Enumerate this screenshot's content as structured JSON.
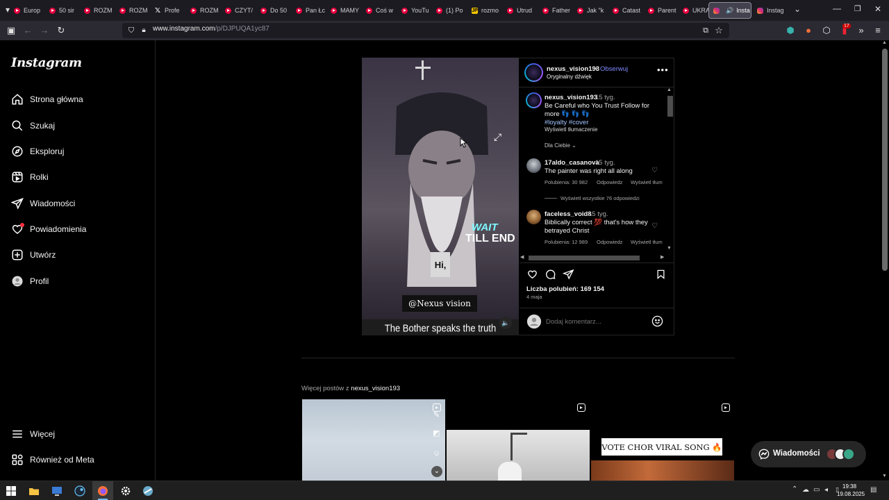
{
  "browser": {
    "tabs": [
      {
        "label": "Europ",
        "icon": "youtube-icon"
      },
      {
        "label": "50 sir",
        "icon": "youtube-icon"
      },
      {
        "label": "ROZM",
        "icon": "youtube-icon"
      },
      {
        "label": "ROZM",
        "icon": "youtube-icon"
      },
      {
        "label": "Profe",
        "icon": "x-icon"
      },
      {
        "label": "ROZM",
        "icon": "youtube-icon"
      },
      {
        "label": "CZYT/",
        "icon": "youtube-icon"
      },
      {
        "label": "Do 50",
        "icon": "youtube-icon"
      },
      {
        "label": "Pan Łc",
        "icon": "youtube-icon"
      },
      {
        "label": "MAMY",
        "icon": "youtube-icon"
      },
      {
        "label": "Coś w",
        "icon": "youtube-icon"
      },
      {
        "label": "YouTu",
        "icon": "youtube-icon"
      },
      {
        "label": "(1) Po",
        "icon": "youtube-icon"
      },
      {
        "label": "rozmo",
        "icon": "jp-icon"
      },
      {
        "label": "Utrud",
        "icon": "youtube-icon"
      },
      {
        "label": "Father",
        "icon": "youtube-icon"
      },
      {
        "label": "Jak \"k",
        "icon": "youtube-icon"
      },
      {
        "label": "Catast",
        "icon": "youtube-icon"
      },
      {
        "label": "Parent",
        "icon": "youtube-icon"
      },
      {
        "label": "UKRA",
        "icon": "youtube-icon"
      }
    ],
    "active_tab": {
      "label": "Insta",
      "icon": "instagram-icon"
    },
    "next_tab": {
      "label": "Instag",
      "icon": "instagram-icon"
    },
    "url_host": "www.instagram.com",
    "url_path": "/p/DJPUQA1yc87",
    "extension_badge": "17"
  },
  "sidebar": {
    "logo": "Instagram",
    "items": [
      {
        "label": "Strona główna",
        "icon": "home-icon"
      },
      {
        "label": "Szukaj",
        "icon": "search-icon"
      },
      {
        "label": "Eksploruj",
        "icon": "explore-icon"
      },
      {
        "label": "Rolki",
        "icon": "reels-icon"
      },
      {
        "label": "Wiadomości",
        "icon": "messages-icon"
      },
      {
        "label": "Powiadomienia",
        "icon": "heart-icon"
      },
      {
        "label": "Utwórz",
        "icon": "create-icon"
      },
      {
        "label": "Profil",
        "icon": "profile-icon"
      }
    ],
    "bottom_items": [
      {
        "label": "Więcej",
        "icon": "menu-icon"
      },
      {
        "label": "Również od Meta",
        "icon": "meta-icon"
      }
    ]
  },
  "post": {
    "video_overlay": {
      "wait_text": "WAIT",
      "till_end_text": "TILL END",
      "hi_text": "Hi,",
      "watermark": "@Nexus vision",
      "caption": "The Bother speaks the truth"
    },
    "author": "nexus_vision193",
    "follow_label": "Obserwuj",
    "separator": "•",
    "audio": "Oryginalny dźwięk",
    "caption": {
      "username": "nexus_vision193",
      "age": "15 tyg.",
      "text_line1": "Be Careful who You Trust Follow for",
      "text_line2": "more 👣 👣 👣",
      "hashtags": "#loyalty #cover",
      "translate": "Wyświetl tłumaczenie"
    },
    "sort_label": "Dla Ciebie",
    "comments": [
      {
        "username": "17aldo_casanova",
        "age": "15 tyg.",
        "text_line1": "The painter was right all along",
        "text_line2": "",
        "likes": "Polubienia: 30 982",
        "reply": "Odpowiedz",
        "translate": "Wyświetl tłum"
      },
      {
        "username": "faceless_void8",
        "age": "15 tyg.",
        "text_line1": "Biblically correct 💯 that's how they",
        "text_line2": "betrayed Christ",
        "likes": "Polubienia: 12 989",
        "reply": "Odpowiedz",
        "translate": "Wyświetl tłum"
      }
    ],
    "view_replies": "Wyświetl wszystkie 76 odpowiedzi",
    "likes_count": "Liczba polubień: 169 154",
    "date": "4 maja",
    "comment_placeholder": "Dodaj komentarz..."
  },
  "more_posts": {
    "label_prefix": "Więcej postów z",
    "author": "nexus_vision193",
    "thumb3_banner": "VOTE CHOR VIRAL SONG 🔥"
  },
  "messages_pill": {
    "label": "Wiadomości"
  },
  "taskbar": {
    "time": "19:38",
    "date": "19.08.2025"
  }
}
